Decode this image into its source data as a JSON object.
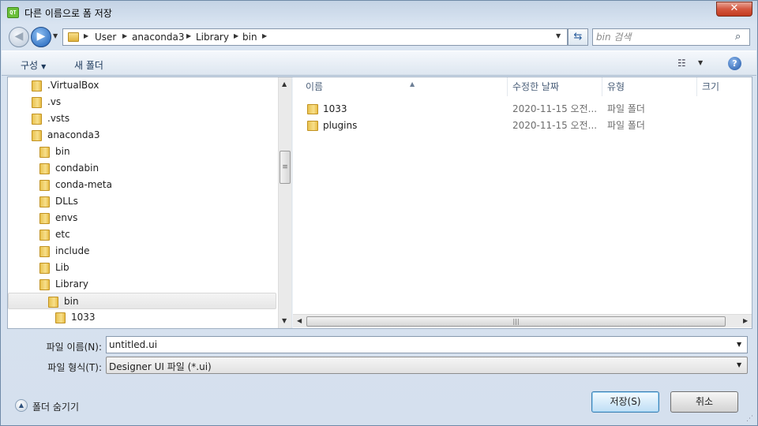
{
  "window": {
    "title": "다른 이름으로 폼 저장",
    "app_icon_text": "QT",
    "close_glyph": "✕"
  },
  "address": {
    "crumbs": [
      "User",
      "anaconda3",
      "Library",
      "bin"
    ],
    "search_placeholder": "bin 검색"
  },
  "commandbar": {
    "organize": "구성",
    "new_folder": "새 폴더"
  },
  "nav_tree": [
    {
      "label": ".VirtualBox",
      "level": 0
    },
    {
      "label": ".vs",
      "level": 0
    },
    {
      "label": ".vsts",
      "level": 0
    },
    {
      "label": "anaconda3",
      "level": 0
    },
    {
      "label": "bin",
      "level": 1
    },
    {
      "label": "condabin",
      "level": 1
    },
    {
      "label": "conda-meta",
      "level": 1
    },
    {
      "label": "DLLs",
      "level": 1
    },
    {
      "label": "envs",
      "level": 1
    },
    {
      "label": "etc",
      "level": 1
    },
    {
      "label": "include",
      "level": 1
    },
    {
      "label": "Lib",
      "level": 1
    },
    {
      "label": "Library",
      "level": 1
    },
    {
      "label": "bin",
      "level": 2,
      "selected": true
    },
    {
      "label": "1033",
      "level": 3
    }
  ],
  "file_list": {
    "columns": [
      "이름",
      "수정한 날짜",
      "유형",
      "크기"
    ],
    "rows": [
      {
        "name": "1033",
        "date": "2020-11-15 오전...",
        "type": "파일 폴더"
      },
      {
        "name": "plugins",
        "date": "2020-11-15 오전...",
        "type": "파일 폴더"
      }
    ]
  },
  "fields": {
    "filename_label": "파일 이름(N):",
    "filename_value": "untitled.ui",
    "filetype_label": "파일 형식(T):",
    "filetype_value": "Designer UI 파일 (*.ui)"
  },
  "footer": {
    "hide_folders": "폴더 숨기기",
    "save": "저장(S)",
    "cancel": "취소"
  }
}
